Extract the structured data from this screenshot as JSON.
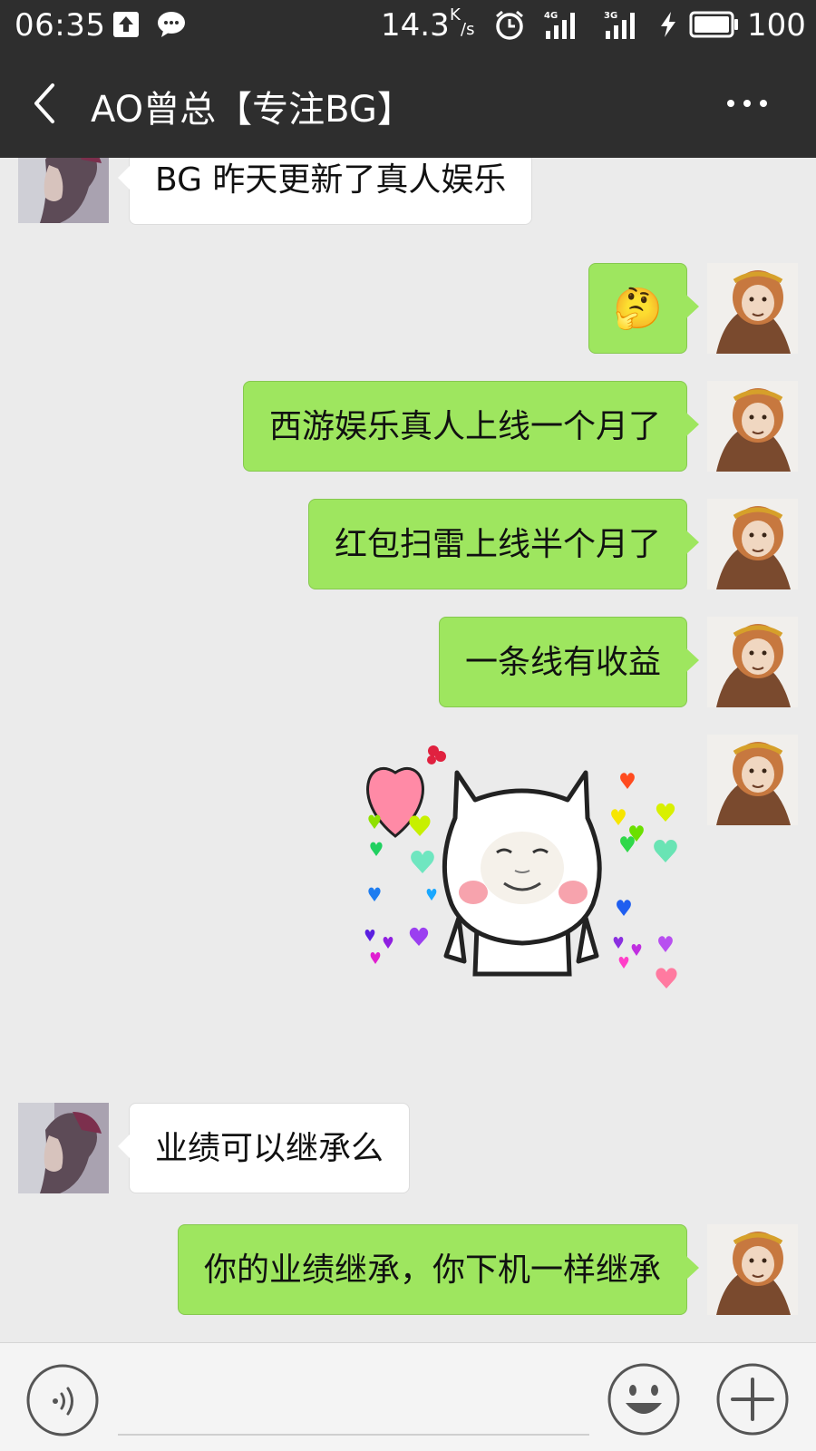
{
  "status_bar": {
    "time": "06:35",
    "net_speed": "14.3",
    "net_speed_unit_top": "K",
    "net_speed_unit_bottom": "/s",
    "signal1_label": "4G",
    "signal2_label": "3G",
    "battery": "100"
  },
  "header": {
    "title": "AO曾总【专注BG】"
  },
  "messages": [
    {
      "side": "in",
      "text": "BG 昨天更新了真人娱乐"
    },
    {
      "side": "out",
      "type": "emoji",
      "emoji": "🤔"
    },
    {
      "side": "out",
      "text": "西游娱乐真人上线一个月了"
    },
    {
      "side": "out",
      "text": "红包扫雷上线半个月了"
    },
    {
      "side": "out",
      "text": "一条线有收益"
    },
    {
      "side": "out",
      "type": "sticker",
      "sticker": "cat-face-hearts-sticker"
    },
    {
      "side": "in",
      "text": "业绩可以继承么"
    },
    {
      "side": "out",
      "text": "你的业绩继承，你下机一样继承"
    }
  ],
  "input": {
    "value": "",
    "placeholder": ""
  },
  "colors": {
    "topbar": "#2e2e2e",
    "chat_bg": "#ebebeb",
    "out_bubble": "#9ee65f",
    "in_bubble": "#ffffff"
  }
}
